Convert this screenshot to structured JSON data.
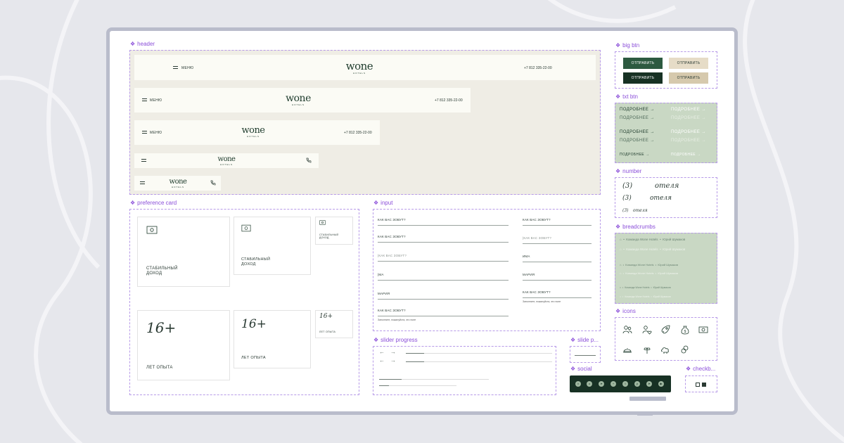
{
  "colors": {
    "accent_purple": "#8b4fd9",
    "brand_green_dark": "#1e3b2c",
    "button_green": "#2d5a40",
    "button_beige": "#e6dcc7",
    "sage_panel": "#c9d8c4",
    "header_bg": "#efede5"
  },
  "sections": {
    "header": "header",
    "big_btn": "big btn",
    "txt_btn": "txt btn",
    "number": "number",
    "breadcrumbs": "breadcrumbs",
    "icons": "icons",
    "preference_card": "preference card",
    "input": "input",
    "slider_progress": "slider progress",
    "slide_p": "slide p...",
    "social": "social",
    "checkbox": "checkb..."
  },
  "header": {
    "menu_label": "МЕНЮ",
    "phone": "+7 812 335-22-00",
    "logo_text": "wone",
    "logo_sub": "HOTELS"
  },
  "big_btn": {
    "label": "ОТПРАВИТЬ"
  },
  "txt_btn": {
    "label": "ПОДРОБНЕЕ"
  },
  "number": {
    "value": "(3)",
    "word": "отеля"
  },
  "breadcrumbs": {
    "item1": "Команда Wone Hotels",
    "item2": "Юрий Шумаков"
  },
  "preference_card": {
    "label1": "СТАБИЛЬНЫЙ",
    "label2": "ДОХОД",
    "years_big": "16+",
    "years_label": "ЛЕТ ОПЫТА"
  },
  "input": {
    "question": "КАК ВАС ЗОВУТ?",
    "question_typing": "|КАК ВАС ЗОВУТ?",
    "typed_partial": "|МА",
    "typed_partial_b": "ИМА",
    "typed_full": "МАРИЯ",
    "error_hint": "Заполните, пожалуйста, это поле"
  },
  "icons": {
    "list": [
      "people-icon",
      "person-heart-icon",
      "rocket-icon",
      "money-bag-icon",
      "banknote-icon",
      "cloche-icon",
      "wheat-icon",
      "cloud-icon",
      "coins-icon"
    ]
  },
  "social": {
    "list": [
      "vk-icon",
      "odnoklassniki-icon",
      "telegram-icon",
      "plus-icon",
      "tenchat-icon",
      "pinterest-icon",
      "telegram-icon",
      "youtube-icon"
    ]
  }
}
